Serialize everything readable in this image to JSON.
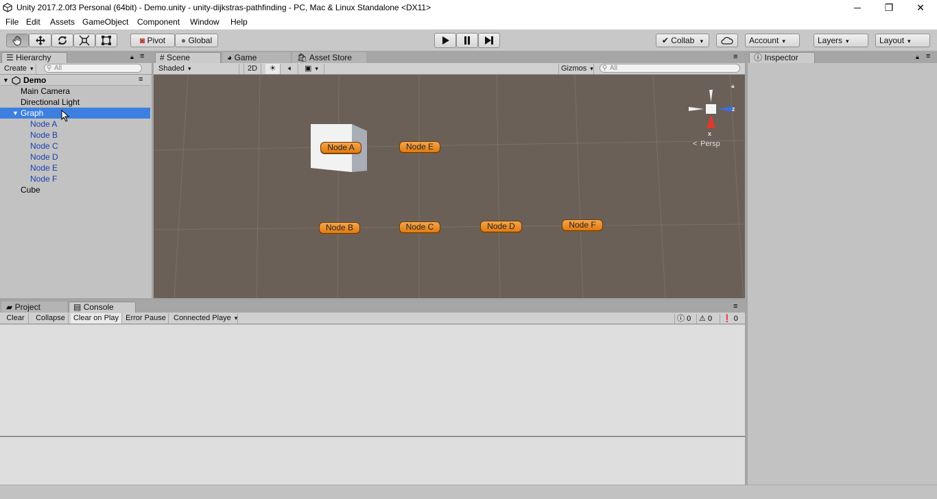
{
  "window": {
    "title": "Unity 2017.2.0f3 Personal (64bit) - Demo.unity - unity-dijkstras-pathfinding - PC, Mac & Linux Standalone <DX11>",
    "minimize": "─",
    "restore": "❐",
    "close": "✕"
  },
  "menu": [
    "File",
    "Edit",
    "Assets",
    "GameObject",
    "Component",
    "Window",
    "Help"
  ],
  "toolbar": {
    "pivot": "Pivot",
    "global": "Global",
    "collab": "Collab",
    "account": "Account",
    "layers": "Layers",
    "layout": "Layout"
  },
  "hierarchy": {
    "tab": "Hierarchy",
    "create": "Create",
    "search_placeholder": "All",
    "scene": "Demo",
    "items": [
      {
        "label": "Main Camera"
      },
      {
        "label": "Directional Light"
      },
      {
        "label": "Graph"
      },
      {
        "label": "Node A"
      },
      {
        "label": "Node B"
      },
      {
        "label": "Node C"
      },
      {
        "label": "Node D"
      },
      {
        "label": "Node E"
      },
      {
        "label": "Node F"
      },
      {
        "label": "Cube"
      }
    ]
  },
  "scene_view": {
    "tabs": [
      "Scene",
      "Game",
      "Asset Store"
    ],
    "shading": "Shaded",
    "mode_2d": "2D",
    "gizmos": "Gizmos",
    "search_placeholder": "All",
    "gizmo_x": "x",
    "gizmo_z": "z",
    "persp": "Persp",
    "nodes": [
      "Node A",
      "Node E",
      "Node B",
      "Node C",
      "Node D",
      "Node F"
    ]
  },
  "inspector": {
    "tab": "Inspector"
  },
  "console": {
    "tabs": [
      "Project",
      "Console"
    ],
    "buttons": [
      "Clear",
      "Collapse",
      "Clear on Play",
      "Error Pause",
      "Connected Playe"
    ],
    "info_count": "0",
    "warning_count": "0",
    "error_count": "0"
  },
  "colors": {
    "selection": "#3d7fe0",
    "child_text": "#1a3fb0",
    "scene_bg": "#6a6058",
    "node_fill": "#e88a20"
  }
}
